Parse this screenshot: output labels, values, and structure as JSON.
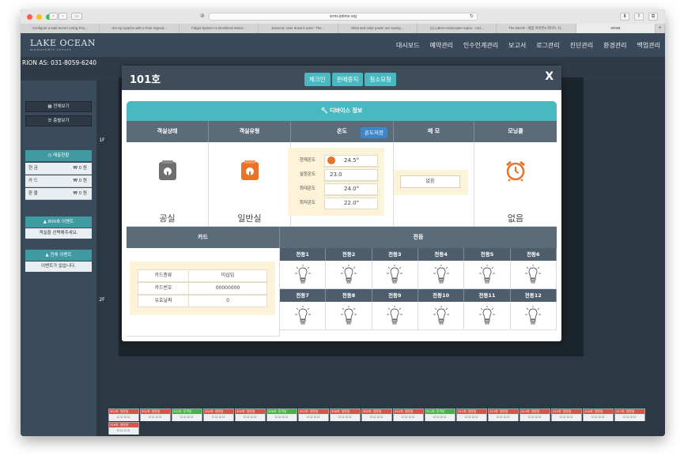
{
  "browser": {
    "url": "srms.iptime.org",
    "tabs": [
      "Configure a Mail Server Using Pos...",
      "Set Up Apache with a Free Signed...",
      "Fidget Spinner to Brushless Motor...",
      "Dovecot: User doesn't exist : The...",
      "Wind and solar power are saving...",
      "(1) Latest ArduCopter topics - Ard...",
      "The DEAR - 제품 아이폰6 화이트 사...",
      "SRSM"
    ],
    "active_tab": 7,
    "new_tab": "+"
  },
  "app": {
    "logo": "LAKE OCEAN",
    "logo_sub": "memorable resort",
    "menu": [
      "대시보드",
      "예약관리",
      "인수인계관리",
      "보고서",
      "로그관리",
      "진단관리",
      "환경관리",
      "백업관리"
    ],
    "rion": "RION AS: 031-8059-6240"
  },
  "left_panel": {
    "view_all": "전체보기",
    "floor_view": "층별보기",
    "sales_title": "매출현황",
    "sales": [
      {
        "label": "현 금",
        "value": "₩ 0 원"
      },
      {
        "label": "카 드",
        "value": "₩ 0 원"
      },
      {
        "label": "환 불",
        "value": "₩ 0 원"
      }
    ],
    "room_event_title": "800호 이벤트",
    "room_event_msg": "객실을 선택해주세요.",
    "all_event_title": "전체 이벤트",
    "all_event_msg": "이벤트가 없습니다."
  },
  "grid": {
    "floor1": "1F",
    "floor2": "2F",
    "vacant_label": "공실",
    "room_type": "일반실",
    "floor3_rooms": [
      "301호",
      "302호",
      "303호",
      "304호",
      "305호",
      "306호",
      "307호",
      "308호",
      "309호",
      "310호",
      "311호",
      "312호",
      "313호",
      "314호",
      "315호",
      "316호",
      "317호",
      "318호"
    ],
    "floor3_status": [
      "일반실",
      "일반실",
      "준객실",
      "일반실",
      "일반실",
      "준객실",
      "일반실",
      "일반실",
      "일반실",
      "일반실",
      "준객실",
      "일반실",
      "일반실",
      "일반실",
      "일반실",
      "일반실",
      "일반실",
      "일반실"
    ]
  },
  "modal": {
    "title": "101호",
    "buttons": [
      "체크인",
      "판매중지",
      "청소요청"
    ],
    "close": "X",
    "device_info": "디바이스 정보",
    "headers": [
      "객실상태",
      "객실유형",
      "온도",
      "메 모",
      "모닝콜"
    ],
    "room_state": "공실",
    "room_type": "일반실",
    "temp_save": "온도저장",
    "temps": [
      {
        "label": "현재온도",
        "value": "24.5°"
      },
      {
        "label": "설정온도",
        "value": "23.0"
      },
      {
        "label": "최대온도",
        "value": "24.0°"
      },
      {
        "label": "최저온도",
        "value": "22.0°"
      }
    ],
    "memo": "없음",
    "morning_call": "없음",
    "card_header": "카드",
    "card": [
      {
        "label": "카드종류",
        "value": "미삽입"
      },
      {
        "label": "카드번호",
        "value": "00000000"
      },
      {
        "label": "유효날짜",
        "value": "0"
      }
    ],
    "lamp_header": "전등",
    "lamps": [
      "전등1",
      "전등2",
      "전등3",
      "전등4",
      "전등5",
      "전등6",
      "전등7",
      "전등8",
      "전등9",
      "전등10",
      "전등11",
      "전등12"
    ]
  },
  "colors": {
    "teal": "#49b9c1",
    "header_dark": "#3e4b58",
    "section_gray": "#5a6b7a",
    "room_red": "#d9534f",
    "icon_orange": "#e8732a"
  }
}
